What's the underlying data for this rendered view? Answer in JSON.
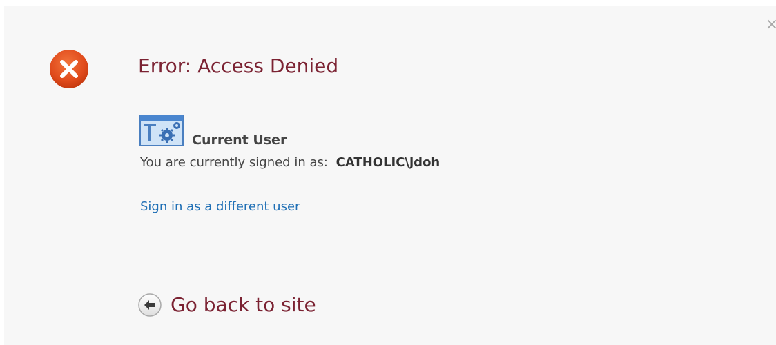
{
  "dialog": {
    "close_glyph": "×",
    "title": "Error: Access Denied",
    "error_icon": "error-x-circle",
    "current_user": {
      "icon": "user-settings-icon",
      "heading": "Current User",
      "signed_in_label": "You are currently signed in as:",
      "username": "CATHOLIC\\jdoh"
    },
    "sign_in_different": "Sign in as a different user",
    "go_back": {
      "icon": "back-arrow-circle",
      "label": "Go back to site"
    }
  },
  "colors": {
    "background": "#f7f7f7",
    "title": "#7b2232",
    "link": "#1f6fb5",
    "error_icon": "#e34d1a",
    "text": "#444444"
  }
}
